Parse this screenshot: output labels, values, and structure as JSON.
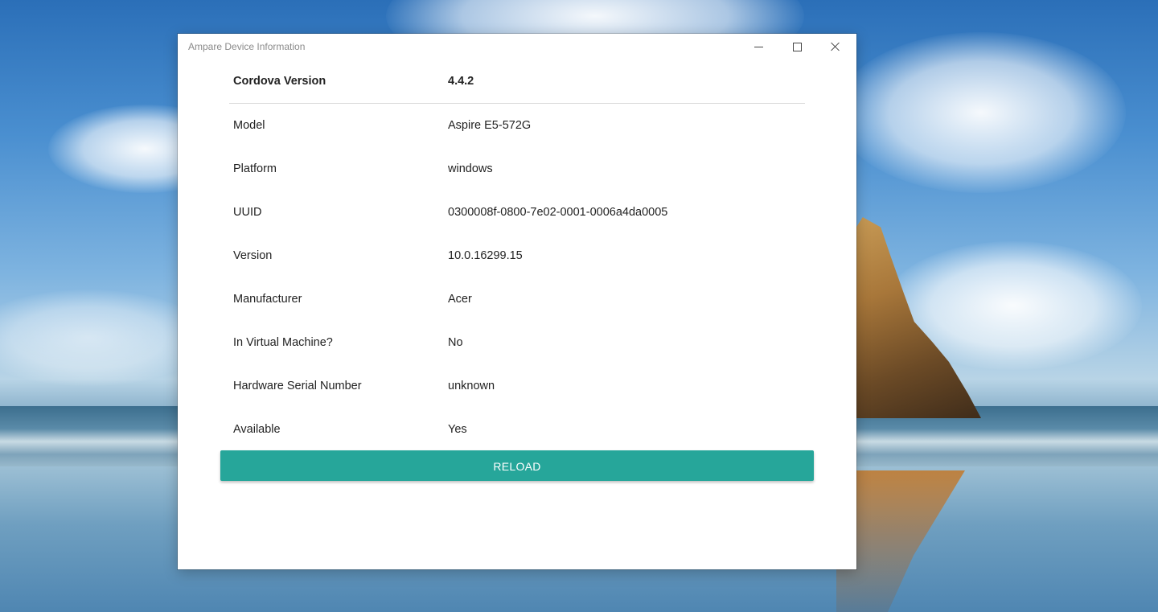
{
  "window": {
    "title": "Ampare Device Information"
  },
  "info": {
    "header": {
      "label": "Cordova Version",
      "value": "4.4.2"
    },
    "rows": [
      {
        "label": "Model",
        "value": "Aspire E5-572G"
      },
      {
        "label": "Platform",
        "value": "windows"
      },
      {
        "label": "UUID",
        "value": "0300008f-0800-7e02-0001-0006a4da0005"
      },
      {
        "label": "Version",
        "value": "10.0.16299.15"
      },
      {
        "label": "Manufacturer",
        "value": "Acer"
      },
      {
        "label": "In Virtual Machine?",
        "value": "No"
      },
      {
        "label": "Hardware Serial Number",
        "value": "unknown"
      },
      {
        "label": "Available",
        "value": "Yes"
      }
    ]
  },
  "actions": {
    "reload_label": "RELOAD"
  },
  "colors": {
    "accent": "#26a69a"
  },
  "icons": {
    "minimize": "minimize-icon",
    "maximize": "maximize-icon",
    "close": "close-icon"
  }
}
